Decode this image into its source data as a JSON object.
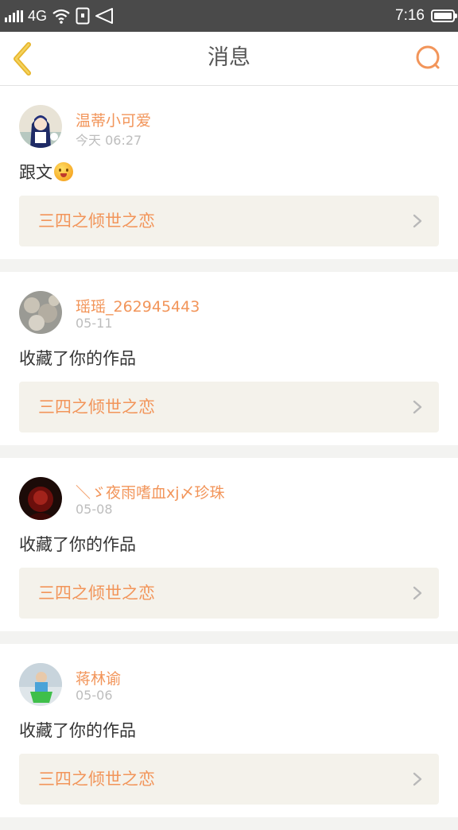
{
  "status_bar": {
    "network": "4G",
    "time": "7:16"
  },
  "header": {
    "title": "消息"
  },
  "messages": [
    {
      "username": "温蒂小可爱",
      "time": "今天 06:27",
      "action": "跟文",
      "emoji": "smiling-face-emoji",
      "work_title": "三四之倾世之恋"
    },
    {
      "username": "瑶瑶_262945443",
      "time": "05-11",
      "action": "收藏了你的作品",
      "work_title": "三四之倾世之恋"
    },
    {
      "username": "＼ゞ夜雨嗜血xj〆珍珠",
      "time": "05-08",
      "action": "收藏了你的作品",
      "work_title": "三四之倾世之恋"
    },
    {
      "username": "蒋林谕",
      "time": "05-06",
      "action": "收藏了你的作品",
      "work_title": "三四之倾世之恋"
    }
  ],
  "colors": {
    "accent": "#f2955a",
    "status_bar": "#4a4a4a",
    "background": "#f3f3f1",
    "link_box": "#f4f2eb"
  }
}
